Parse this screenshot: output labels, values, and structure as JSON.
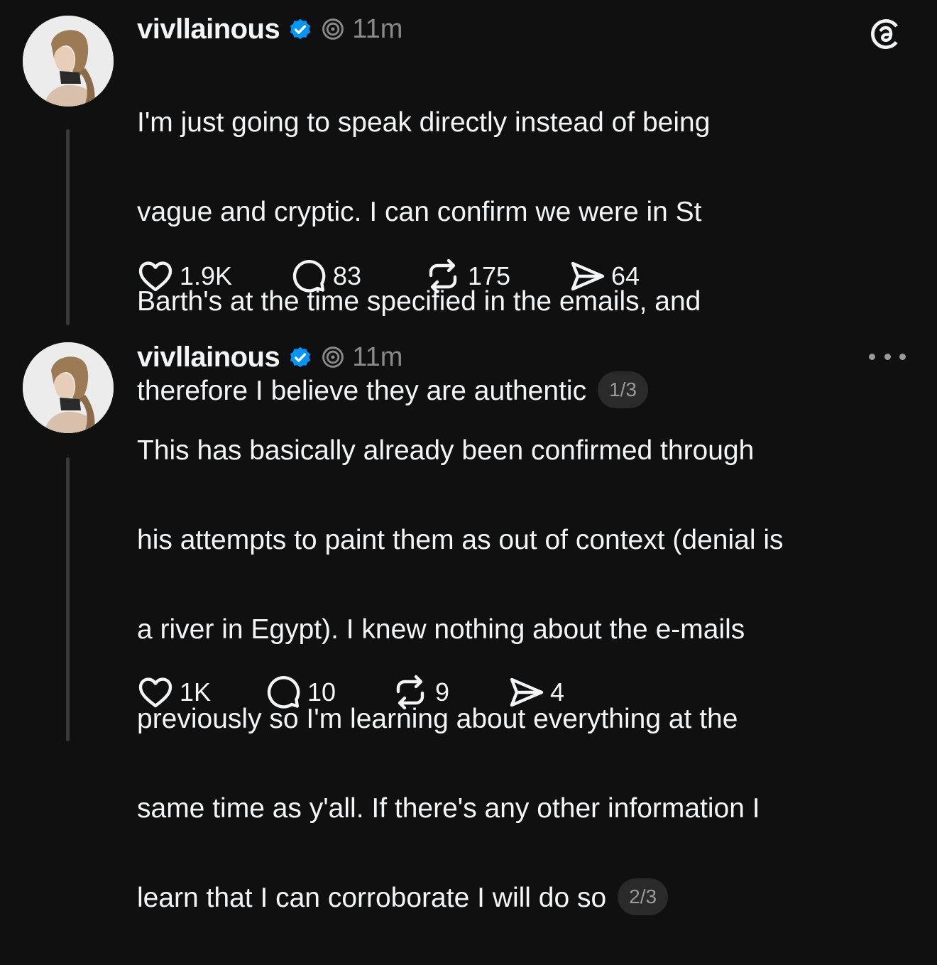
{
  "posts": [
    {
      "username": "vivllainous",
      "time": "11m",
      "top_icon": "threads-logo-icon",
      "lines": [
        "I'm just going to speak directly instead of being",
        "vague and cryptic. I can confirm we were in St",
        "Barth's at the time specified in the emails, and",
        "therefore I believe they are authentic"
      ],
      "pager": "1/3",
      "likes": "1.9K",
      "replies": "83",
      "reposts": "175",
      "shares": "64"
    },
    {
      "username": "vivllainous",
      "time": "11m",
      "top_icon": "more-options-icon",
      "lines": [
        "This has basically already been confirmed through",
        "his attempts to paint them as out of context (denial is",
        "a river in Egypt). I knew nothing about the e-mails",
        "previously so I'm learning about everything at the",
        "same time as y'all. If there's any other information I",
        "learn that I can corroborate I will do so"
      ],
      "pager": "2/3",
      "likes": "1K",
      "replies": "10",
      "reposts": "9",
      "shares": "4"
    }
  ],
  "colors": {
    "background": "#101010",
    "text": "#f3f5f7",
    "muted": "#8a8a8a",
    "verified": "#0095f6",
    "thread_line": "#3a3a3a"
  }
}
